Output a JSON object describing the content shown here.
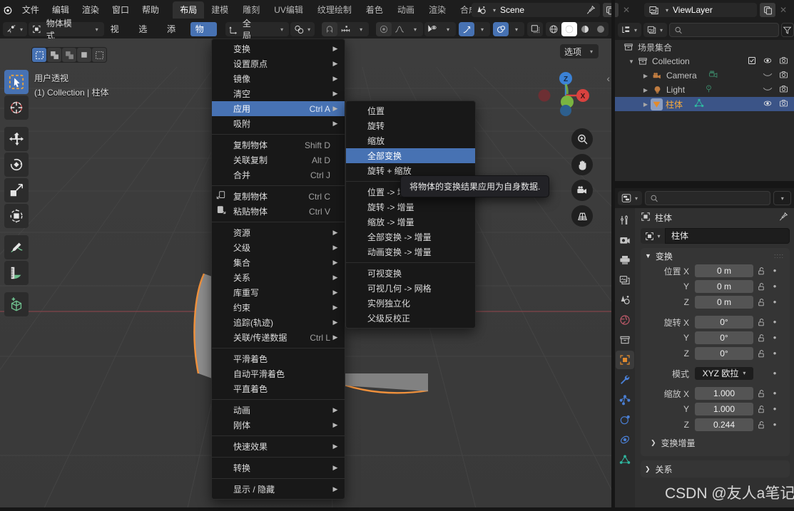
{
  "app": {
    "logo_icon": "blender-logo",
    "menus": [
      "文件",
      "编辑",
      "渲染",
      "窗口",
      "帮助"
    ],
    "workspace_tabs": [
      {
        "label": "布局",
        "active": true
      },
      {
        "label": "建模",
        "active": false
      },
      {
        "label": "雕刻",
        "active": false
      },
      {
        "label": "UV编辑",
        "active": false
      },
      {
        "label": "纹理绘制",
        "active": false
      },
      {
        "label": "着色",
        "active": false
      },
      {
        "label": "动画",
        "active": false
      },
      {
        "label": "渲染",
        "active": false
      },
      {
        "label": "合成",
        "active": false
      }
    ],
    "scene": {
      "name": "Scene",
      "icon": "scene-icon",
      "pin_icon": "pin-icon",
      "copy_icon": "duplicate-icon",
      "close_icon": "close-icon"
    },
    "viewlayer": {
      "name": "ViewLayer",
      "icon": "viewlayer-icon",
      "copy_icon": "duplicate-icon",
      "close_icon": "close-icon"
    }
  },
  "viewport_header": {
    "editor_type_icon": "editor-type-icon",
    "mode": "物体模式",
    "menus": [
      "视图",
      "选择",
      "添加",
      "物体"
    ],
    "active_menu": "物体",
    "transform_orientation": {
      "icon": "orientation-icon",
      "value": "全局"
    },
    "pivot_icon": "pivot-point-icon",
    "snap_magnet_icon": "magnet-icon",
    "snap_icon": "snap-increment-icon",
    "proportional_icon": "proportional-edit-icon",
    "falloff_icon": "falloff-curve-icon",
    "visibility_icon": "object-visibility-icon",
    "gizmo_icon": "gizmo-icon",
    "overlays_icon": "overlays-icon",
    "xray_icon": "xray-icon",
    "shading_modes": [
      "wireframe-icon",
      "solid-icon",
      "material-preview-icon",
      "rendered-icon"
    ],
    "shading_active_index": 1
  },
  "viewport": {
    "perspective_label": "用户透视",
    "collection_label": "(1) Collection | 柱体",
    "options_label": "选项",
    "gizmo_axes": [
      {
        "label": "Z",
        "color": "#3b82d6"
      },
      {
        "label": "X",
        "color": "#d9423f"
      },
      {
        "label": "Y",
        "color": "#7ab441"
      }
    ],
    "nav_buttons": [
      "zoom-icon",
      "pan-hand-icon",
      "camera-view-icon",
      "toggle-perspective-icon"
    ],
    "tools": [
      {
        "name": "tweak-select-tool",
        "icon": "cursor-select-icon",
        "active": true
      },
      {
        "name": "cursor-tool",
        "icon": "3d-cursor-icon",
        "active": false
      },
      {
        "name": "move-tool",
        "icon": "move-arrows-icon",
        "active": false
      },
      {
        "name": "rotate-tool",
        "icon": "rotate-icon",
        "active": false
      },
      {
        "name": "scale-tool",
        "icon": "scale-icon",
        "active": false
      },
      {
        "name": "transform-tool",
        "icon": "transform-icon",
        "active": false
      },
      {
        "name": "annotate-tool",
        "icon": "pencil-icon",
        "active": false
      },
      {
        "name": "measure-tool",
        "icon": "ruler-icon",
        "active": false
      },
      {
        "name": "add-cube-tool",
        "icon": "add-cube-icon",
        "active": false
      }
    ],
    "select_modes": [
      "select-set-icon",
      "select-extend-icon",
      "select-subtract-icon",
      "select-invert-icon",
      "select-intersect-icon"
    ]
  },
  "object_menu": {
    "items": [
      {
        "label": "变换",
        "shortcut": "",
        "submenu": true,
        "icon": ""
      },
      {
        "label": "设置原点",
        "shortcut": "",
        "submenu": true,
        "icon": ""
      },
      {
        "label": "镜像",
        "shortcut": "",
        "submenu": true,
        "icon": ""
      },
      {
        "label": "清空",
        "shortcut": "",
        "submenu": true,
        "icon": ""
      },
      {
        "label": "应用",
        "shortcut": "Ctrl A",
        "submenu": true,
        "icon": "",
        "highlight": true
      },
      {
        "label": "吸附",
        "shortcut": "",
        "submenu": true,
        "icon": ""
      },
      {
        "separator": true
      },
      {
        "label": "复制物体",
        "shortcut": "Shift D",
        "submenu": false,
        "icon": ""
      },
      {
        "label": "关联复制",
        "shortcut": "Alt D",
        "submenu": false,
        "icon": ""
      },
      {
        "label": "合并",
        "shortcut": "Ctrl J",
        "submenu": false,
        "icon": ""
      },
      {
        "separator": true
      },
      {
        "label": "复制物体",
        "shortcut": "Ctrl C",
        "submenu": false,
        "icon": "copy-icon"
      },
      {
        "label": "粘贴物体",
        "shortcut": "Ctrl V",
        "submenu": false,
        "icon": "paste-icon"
      },
      {
        "separator": true
      },
      {
        "label": "资源",
        "shortcut": "",
        "submenu": true,
        "icon": ""
      },
      {
        "label": "父级",
        "shortcut": "",
        "submenu": true,
        "icon": ""
      },
      {
        "label": "集合",
        "shortcut": "",
        "submenu": true,
        "icon": ""
      },
      {
        "label": "关系",
        "shortcut": "",
        "submenu": true,
        "icon": ""
      },
      {
        "label": "库重写",
        "shortcut": "",
        "submenu": true,
        "icon": ""
      },
      {
        "label": "约束",
        "shortcut": "",
        "submenu": true,
        "icon": ""
      },
      {
        "label": "追踪(轨迹)",
        "shortcut": "",
        "submenu": true,
        "icon": ""
      },
      {
        "label": "关联/传递数据",
        "shortcut": "Ctrl L",
        "submenu": true,
        "icon": ""
      },
      {
        "separator": true
      },
      {
        "label": "平滑着色",
        "shortcut": "",
        "submenu": false,
        "icon": ""
      },
      {
        "label": "自动平滑着色",
        "shortcut": "",
        "submenu": false,
        "icon": ""
      },
      {
        "label": "平直着色",
        "shortcut": "",
        "submenu": false,
        "icon": ""
      },
      {
        "separator": true
      },
      {
        "label": "动画",
        "shortcut": "",
        "submenu": true,
        "icon": ""
      },
      {
        "label": "刚体",
        "shortcut": "",
        "submenu": true,
        "icon": ""
      },
      {
        "separator": true
      },
      {
        "label": "快速效果",
        "shortcut": "",
        "submenu": true,
        "icon": ""
      },
      {
        "separator": true
      },
      {
        "label": "转换",
        "shortcut": "",
        "submenu": true,
        "icon": ""
      },
      {
        "separator": true
      },
      {
        "label": "显示 / 隐藏",
        "shortcut": "",
        "submenu": true,
        "icon": ""
      }
    ]
  },
  "apply_submenu": {
    "items": [
      {
        "label": "位置",
        "highlight": false
      },
      {
        "label": "旋转",
        "highlight": false
      },
      {
        "label": "缩放",
        "highlight": false
      },
      {
        "label": "全部变换",
        "highlight": true
      },
      {
        "label": "旋转 + 缩放",
        "highlight": false
      },
      {
        "separator": true
      },
      {
        "label": "位置 -> 增量",
        "highlight": false
      },
      {
        "label": "旋转 -> 增量",
        "highlight": false
      },
      {
        "label": "缩放 -> 增量",
        "highlight": false
      },
      {
        "label": "全部变换 -> 增量",
        "highlight": false
      },
      {
        "label": "动画变换 -> 增量",
        "highlight": false
      },
      {
        "separator": true
      },
      {
        "label": "可视变换",
        "highlight": false
      },
      {
        "label": "可视几何 -> 网格",
        "highlight": false
      },
      {
        "label": "实例独立化",
        "highlight": false
      },
      {
        "label": "父级反校正",
        "highlight": false
      }
    ]
  },
  "tooltip": {
    "text": "将物体的变换结果应用为自身数据."
  },
  "outliner": {
    "display_mode_icon": "outliner-display-icon",
    "filter_scene_icon": "scene-filter-icon",
    "search_placeholder": "",
    "filter_icon": "filter-funnel-icon",
    "rows": [
      {
        "label": "场景集合",
        "icon": "collection-icon",
        "depth": 0,
        "expand": "",
        "selected": false,
        "icons": []
      },
      {
        "label": "Collection",
        "icon": "collection-icon",
        "depth": 1,
        "expand": "▼",
        "selected": false,
        "icons": [
          "checkbox-checked-icon",
          "eye-icon",
          "camera-render-icon"
        ]
      },
      {
        "label": "Camera",
        "icon": "camera-object-icon",
        "data_icon": "camera-data-icon",
        "depth": 2,
        "expand": "▶",
        "selected": false,
        "icons": [
          "eye-closed-icon",
          "camera-render-icon"
        ]
      },
      {
        "label": "Light",
        "icon": "light-object-icon",
        "data_icon": "light-data-icon",
        "depth": 2,
        "expand": "▶",
        "selected": false,
        "icons": [
          "eye-closed-icon",
          "camera-render-icon"
        ]
      },
      {
        "label": "柱体",
        "icon": "mesh-object-icon",
        "data_icon": "mesh-data-icon",
        "depth": 2,
        "expand": "▶",
        "selected": true,
        "icons": [
          "eye-icon",
          "camera-render-icon"
        ]
      }
    ]
  },
  "properties": {
    "editor_icon": "properties-editor-icon",
    "search_placeholder": "",
    "breadcrumb": "柱体",
    "breadcrumb_icon": "object-icon",
    "pin_icon": "pin-icon",
    "object_name": "柱体",
    "tabs": [
      {
        "name": "tool-tab",
        "icon": "tool-icon",
        "active": false,
        "color": "#c8c8c8"
      },
      {
        "name": "render-tab",
        "icon": "render-camera-icon",
        "active": false,
        "color": "#c8c8c8"
      },
      {
        "name": "output-tab",
        "icon": "printer-icon",
        "active": false,
        "color": "#c8c8c8"
      },
      {
        "name": "viewlayer-tab",
        "icon": "images-icon",
        "active": false,
        "color": "#c8c8c8"
      },
      {
        "name": "scene-tab",
        "icon": "scene-cone-icon",
        "active": false,
        "color": "#c8c8c8"
      },
      {
        "name": "world-tab",
        "icon": "world-globe-icon",
        "active": false,
        "color": "#c05a6a"
      },
      {
        "name": "collection-tab",
        "icon": "collection-box-icon",
        "active": false,
        "color": "#c8c8c8"
      },
      {
        "name": "object-tab",
        "icon": "object-square-icon",
        "active": true,
        "color": "#e08a2e"
      },
      {
        "name": "modifier-tab",
        "icon": "wrench-icon",
        "active": false,
        "color": "#4a7fd4"
      },
      {
        "name": "particles-tab",
        "icon": "particles-icon",
        "active": false,
        "color": "#4a7fd4"
      },
      {
        "name": "physics-tab",
        "icon": "physics-orbit-icon",
        "active": false,
        "color": "#4a7fd4"
      },
      {
        "name": "constraints-tab",
        "icon": "constraint-icon",
        "active": false,
        "color": "#4a7fd4"
      },
      {
        "name": "data-tab",
        "icon": "mesh-data-triangle-icon",
        "active": false,
        "color": "#2fb8a0"
      }
    ],
    "transform_panel": {
      "title": "变换",
      "location": {
        "label": "位置 X",
        "labels": [
          "位置 X",
          "Y",
          "Z"
        ],
        "values": [
          "0 m",
          "0 m",
          "0 m"
        ]
      },
      "rotation": {
        "labels": [
          "旋转 X",
          "Y",
          "Z"
        ],
        "values": [
          "0°",
          "0°",
          "0°"
        ]
      },
      "mode": {
        "label": "模式",
        "value": "XYZ 欧拉"
      },
      "scale": {
        "labels": [
          "缩放 X",
          "Y",
          "Z"
        ],
        "values": [
          "1.000",
          "1.000",
          "0.244"
        ]
      }
    },
    "delta_transform_label": "变换增量",
    "relations_label": "关系"
  },
  "watermark": "CSDN @友人a笔记",
  "colors": {
    "accent_blue": "#4772b3",
    "selected_orange": "#ed9e5c",
    "panel_bg": "#303030",
    "header_bg": "#1d1d1d",
    "viewport_bg": "#3b3b3b",
    "outliner_bg": "#282828"
  }
}
